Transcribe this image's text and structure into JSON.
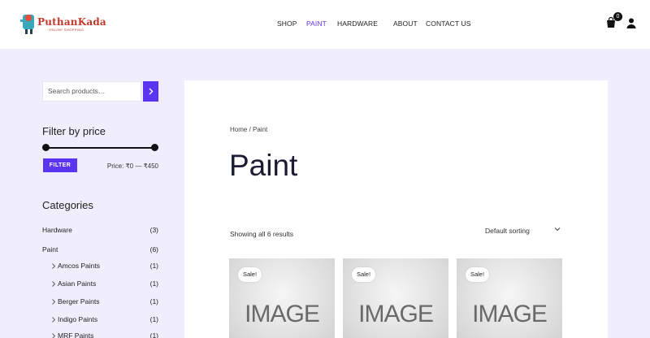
{
  "header": {
    "logo_text": "PuthanKada",
    "logo_tagline": "ONLINE SHOPPING",
    "nav": [
      {
        "label": "SHOP"
      },
      {
        "label": "PAINT"
      },
      {
        "label": "HARDWARE"
      },
      {
        "label": "ABOUT"
      },
      {
        "label": "CONTACT US"
      }
    ],
    "cart_count": "0"
  },
  "sidebar": {
    "search_placeholder": "Search products…",
    "filter_title": "Filter by price",
    "filter_button": "FILTER",
    "price_range_text": "Price: ₹0 — ₹450",
    "categories_title": "Categories",
    "categories": [
      {
        "name": "Hardware",
        "count": "(3)"
      },
      {
        "name": "Paint",
        "count": "(6)"
      },
      {
        "name": "Amcos Paints",
        "count": "(1)"
      },
      {
        "name": "Asian Paints",
        "count": "(1)"
      },
      {
        "name": "Berger Paints",
        "count": "(1)"
      },
      {
        "name": "Indigo Paints",
        "count": "(1)"
      },
      {
        "name": "MRF Paints",
        "count": "(1)"
      }
    ]
  },
  "main": {
    "breadcrumb": "Home / Paint",
    "title": "Paint",
    "results_count": "Showing all 6 results",
    "sorting": "Default sorting",
    "products": [
      {
        "badge": "Sale!",
        "image_text": "IMAGE"
      },
      {
        "badge": "Sale!",
        "image_text": "IMAGE"
      },
      {
        "badge": "Sale!",
        "image_text": "IMAGE"
      }
    ]
  },
  "colors": {
    "accent": "#5c35f2",
    "background": "#f0eefc"
  }
}
